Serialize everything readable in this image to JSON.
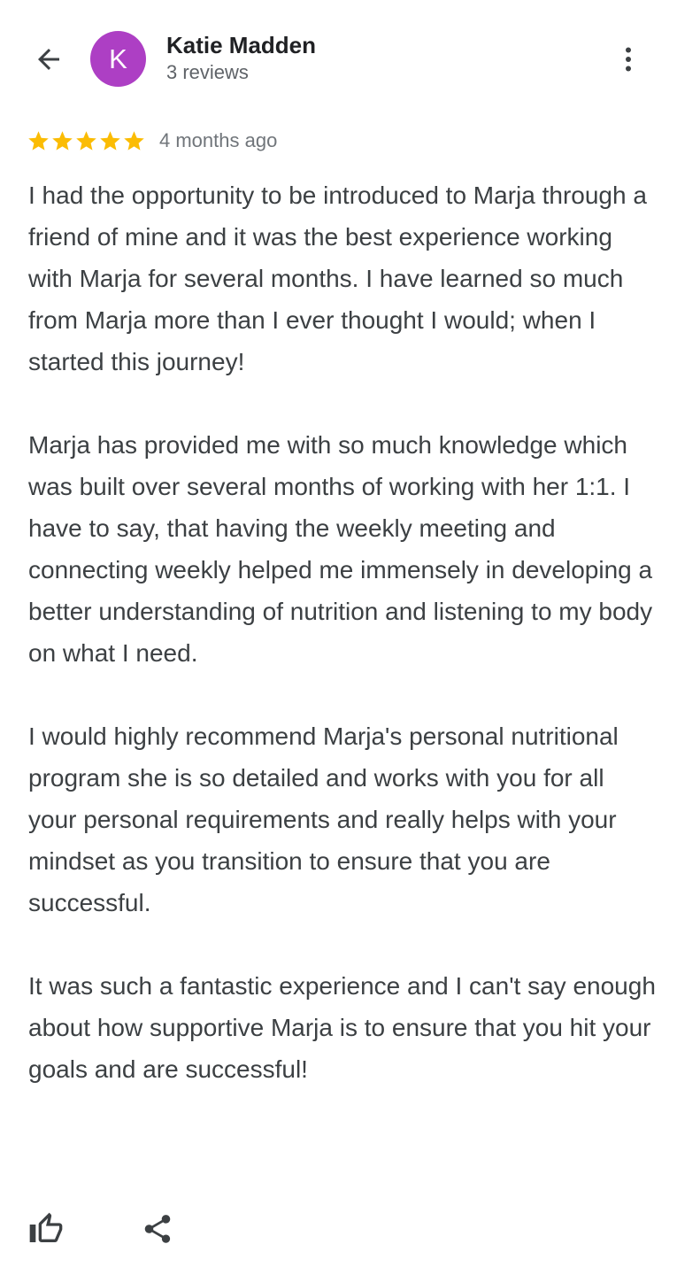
{
  "header": {
    "back_icon": "arrow-back-icon",
    "avatar_letter": "K",
    "avatar_color": "#ad3fc4",
    "reviewer_name": "Katie Madden",
    "review_count": "3 reviews",
    "more_icon": "more-vert-icon"
  },
  "review": {
    "rating": 5,
    "rating_max": 5,
    "star_color": "#fbbc04",
    "date": "4 months ago",
    "paragraphs": [
      "I had the opportunity to be introduced to Marja through a friend of mine and it was the best experience working with Marja for several months. I have learned so much from Marja more than I ever thought I would; when I started this journey!",
      "Marja has provided me with so much knowledge which was built over several months of working with her 1:1. I have to say, that having the weekly meeting and connecting weekly helped me immensely in developing a better understanding of nutrition and listening to my body on what I need.",
      "I would highly recommend Marja's personal nutritional program she is so detailed and works with you for all your personal requirements and really helps with your mindset as you transition to ensure that you are successful.",
      "It was such a fantastic experience and I can't say enough about how supportive Marja is to ensure that you hit your goals and are successful!"
    ]
  },
  "actions": {
    "like_icon": "thumb-up-icon",
    "share_icon": "share-icon"
  }
}
